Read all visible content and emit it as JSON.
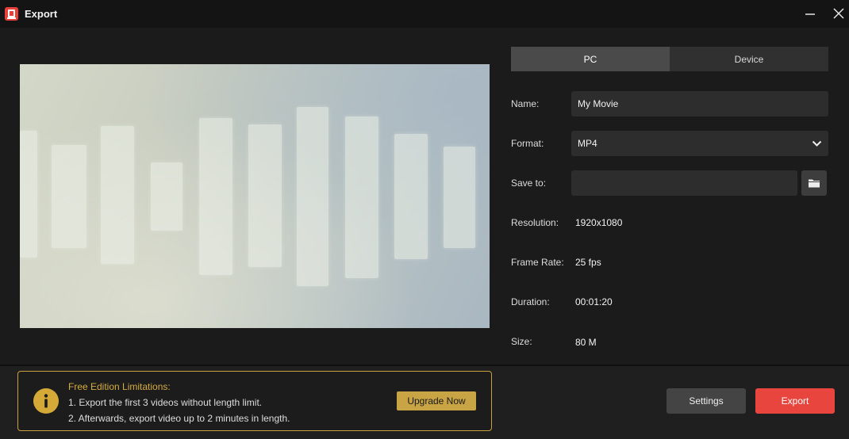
{
  "window": {
    "title": "Export",
    "logo_icon": "app-logo-icon",
    "minimize_icon": "minimize-icon",
    "close_icon": "close-icon"
  },
  "tabs": [
    {
      "label": "PC",
      "active": true
    },
    {
      "label": "Device",
      "active": false
    }
  ],
  "form": {
    "name_label": "Name:",
    "name_value": "My Movie",
    "format_label": "Format:",
    "format_value": "MP4",
    "save_label": "Save to:",
    "save_value": "",
    "folder_icon": "folder-icon",
    "dropdown_icon": "chevron-down-icon"
  },
  "info": {
    "resolution_label": "Resolution:",
    "resolution_value": "1920x1080",
    "framerate_label": "Frame Rate:",
    "framerate_value": "25 fps",
    "duration_label": "Duration:",
    "duration_value": "00:01:20",
    "size_label": "Size:",
    "size_value": "80 M"
  },
  "limitations": {
    "title": "Free Edition Limitations:",
    "line1": "1. Export the first 3 videos without length limit.",
    "line2": "2. Afterwards, export video up to 2 minutes in length.",
    "upgrade_label": "Upgrade Now",
    "icon": "info-icon"
  },
  "actions": {
    "settings_label": "Settings",
    "export_label": "Export"
  },
  "colors": {
    "accent_export": "#e8453f",
    "upgrade_gold": "#c9a445",
    "background": "#1b1b1b"
  }
}
